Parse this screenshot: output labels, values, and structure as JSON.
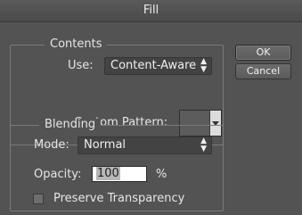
{
  "dialog": {
    "title": "Fill"
  },
  "contents": {
    "legend": "Contents",
    "use_label": "Use:",
    "use_value": "Content-Aware",
    "custom_pattern_label": "Custom Pattern:"
  },
  "buttons": {
    "ok": "OK",
    "cancel": "Cancel"
  },
  "blending": {
    "legend": "Blending",
    "mode_label": "Mode:",
    "mode_value": "Normal",
    "opacity_label": "Opacity:",
    "opacity_value": "100",
    "opacity_unit": "%",
    "preserve_transparency_label": "Preserve Transparency",
    "preserve_transparency_checked": false
  },
  "icons": {
    "select_arrows": "updown-arrows-icon",
    "dropdown": "chevron-down-icon"
  }
}
